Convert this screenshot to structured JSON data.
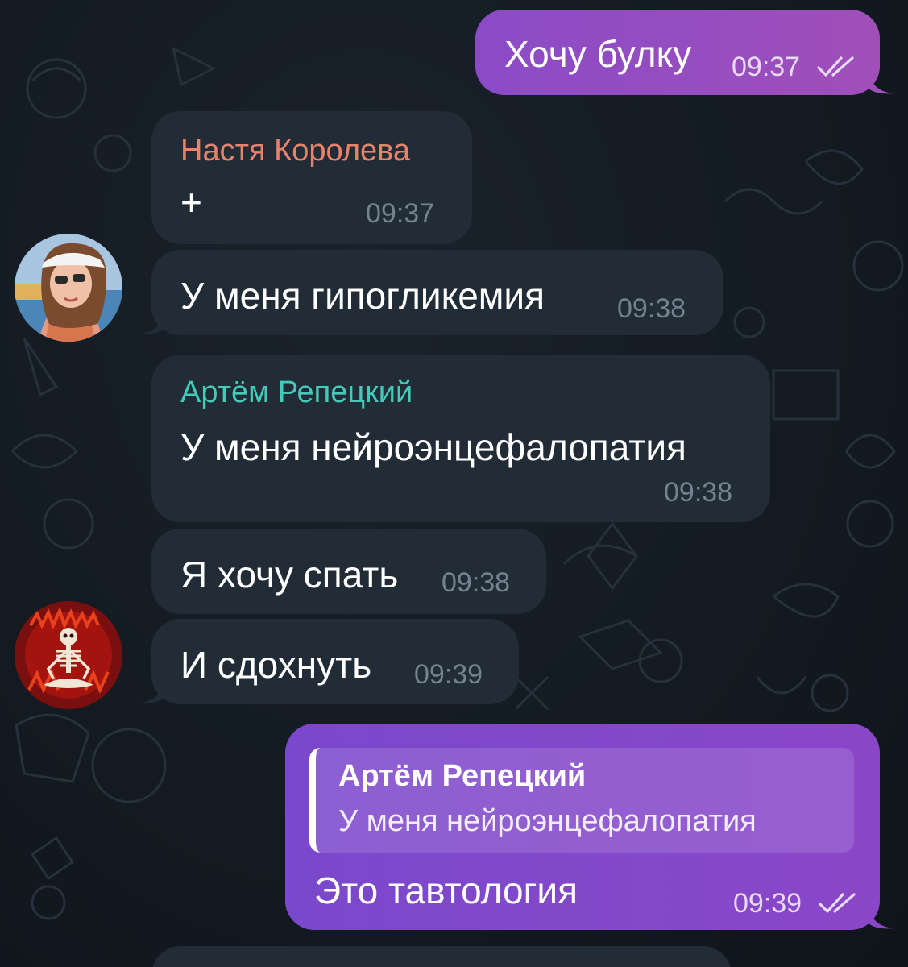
{
  "colors": {
    "background": "#131a21",
    "incoming_bubble": "#212c37",
    "outgoing_pink": "#9a4ec0",
    "outgoing_purple": "#8047ca",
    "sender_nastya": "#e8826a",
    "sender_artem": "#45c9b8",
    "time_incoming": "#75828f"
  },
  "messages": [
    {
      "id": "m1",
      "direction": "outgoing",
      "text": "Хочу булку",
      "time": "09:37",
      "status": "read"
    },
    {
      "id": "m2",
      "direction": "incoming",
      "sender": "Настя Королева",
      "text": "+",
      "time": "09:37"
    },
    {
      "id": "m3",
      "direction": "incoming",
      "text": "У меня гипогликемия",
      "time": "09:38"
    },
    {
      "id": "m4",
      "direction": "incoming",
      "sender": "Артём Репецкий",
      "text": "У меня нейроэнцефалопатия",
      "time": "09:38"
    },
    {
      "id": "m5",
      "direction": "incoming",
      "text": "Я хочу спать",
      "time": "09:38"
    },
    {
      "id": "m6",
      "direction": "incoming",
      "text": "И сдохнуть",
      "time": "09:39"
    },
    {
      "id": "m7",
      "direction": "outgoing",
      "reply": {
        "sender": "Артём Репецкий",
        "text": "У меня нейроэнцефалопатия"
      },
      "text": "Это тавтология",
      "time": "09:39",
      "status": "read"
    }
  ],
  "avatars": [
    {
      "name": "avatar-nastya",
      "icon": "user-photo"
    },
    {
      "name": "avatar-artem",
      "icon": "skeleton-meditation-art"
    }
  ]
}
